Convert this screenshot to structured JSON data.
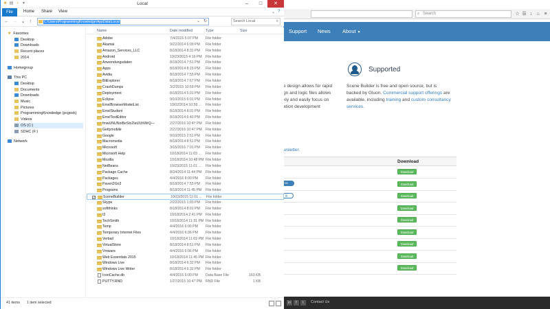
{
  "browser": {
    "search_placeholder": "Search",
    "nav": {
      "support": "Support",
      "news": "News",
      "about": "About"
    },
    "supported_title": "Supported",
    "left_lines": [
      "e design allows for rapid",
      "gn and logic files allows",
      "kly and easily focus on",
      "ation development"
    ],
    "right_text": {
      "l1": "Scene Builder is free and open source, but is",
      "l2a": "backed by Gluon. ",
      "l2_link": "Commercial support offerings",
      "l2b": " are",
      "l3a": "available, including ",
      "l3_link1": "training",
      "l3_mid": " and ",
      "l3_link2": "custom consultancy",
      "l4_link": "services",
      "l4b": "."
    },
    "newsletter": "wsletter.",
    "table_header": "Download",
    "download_label": "Download",
    "download_rows": 9,
    "pill_1": "ris",
    "pill_2": "Ⅲ",
    "footer_contact": "Contact Us",
    "accent": "#3d7fb8",
    "green": "#5cb85c"
  },
  "explorer": {
    "title": "Local",
    "tabs": {
      "file": "File",
      "home": "Home",
      "share": "Share",
      "view": "View"
    },
    "path": "C:\\Users\\ProgrammingKnowledge\\AppData\\Local",
    "search_placeholder": "Search Local",
    "nav_items": [
      {
        "label": "Favorites",
        "kind": "star",
        "indent": 0
      },
      {
        "label": "Desktop",
        "kind": "blue",
        "indent": 1
      },
      {
        "label": "Downloads",
        "kind": "blue",
        "indent": 1
      },
      {
        "label": "Recent places",
        "kind": "folder",
        "indent": 1
      },
      {
        "label": "2014",
        "kind": "folder",
        "indent": 1
      },
      {
        "label": "",
        "kind": "gap",
        "indent": 0
      },
      {
        "label": "Homegroup",
        "kind": "blue",
        "indent": 0
      },
      {
        "label": "",
        "kind": "gap",
        "indent": 0
      },
      {
        "label": "This PC",
        "kind": "pc",
        "indent": 0
      },
      {
        "label": "Desktop",
        "kind": "blue",
        "indent": 1
      },
      {
        "label": "Documents",
        "kind": "folder",
        "indent": 1
      },
      {
        "label": "Downloads",
        "kind": "blue",
        "indent": 1
      },
      {
        "label": "Music",
        "kind": "folder",
        "indent": 1
      },
      {
        "label": "Pictures",
        "kind": "folder",
        "indent": 1
      },
      {
        "label": "ProgrammingKnowledge (pcgeek)",
        "kind": "folder",
        "indent": 1
      },
      {
        "label": "Videos",
        "kind": "folder",
        "indent": 1
      },
      {
        "label": "OS (C:)",
        "kind": "drive",
        "indent": 1
      },
      {
        "label": "SDHC (F:)",
        "kind": "drive",
        "indent": 1
      },
      {
        "label": "",
        "kind": "gap",
        "indent": 0
      },
      {
        "label": "Network",
        "kind": "blue",
        "indent": 0
      }
    ],
    "columns": {
      "name": "Name",
      "date": "Date modified",
      "type": "Type",
      "size": "Size"
    },
    "files": [
      {
        "name": "Adobe",
        "date": "7/4/2015 5:07 PM",
        "type": "File folder",
        "size": ""
      },
      {
        "name": "Akamai",
        "date": "9/22/2014 6:09 PM",
        "type": "File folder",
        "size": ""
      },
      {
        "name": "Amazon_Services_LLC",
        "date": "8/18/2014 8:31 PM",
        "type": "File folder",
        "size": ""
      },
      {
        "name": "Android",
        "date": "10/23/2015 4:16 PM",
        "type": "File folder",
        "size": ""
      },
      {
        "name": "Anwendungsdaten",
        "date": "8/18/2014 7:51 PM",
        "type": "File folder",
        "size": ""
      },
      {
        "name": "Apps",
        "date": "8/18/2014 8:15 PM",
        "type": "File folder",
        "size": ""
      },
      {
        "name": "Avidia",
        "date": "8/18/2014 7:55 PM",
        "type": "File folder",
        "size": ""
      },
      {
        "name": "BitExplorer",
        "date": "8/18/2014 7:57 PM",
        "type": "File folder",
        "size": ""
      },
      {
        "name": "CrashDumps",
        "date": "3/2/2015 10:59 PM",
        "type": "File folder",
        "size": ""
      },
      {
        "name": "Deployment",
        "date": "8/18/2014 5:01 PM",
        "type": "File folder",
        "size": ""
      },
      {
        "name": "Eclipse",
        "date": "9/10/2015 6:01 PM",
        "type": "File folder",
        "size": ""
      },
      {
        "name": "EmxlBrowserModelList",
        "date": "10/02/2014 10:59 ...",
        "type": "File folder",
        "size": ""
      },
      {
        "name": "EmxlStudent",
        "date": "8/18/2014 8:01 PM",
        "type": "File folder",
        "size": ""
      },
      {
        "name": "EmxlTextEditor",
        "date": "8/18/2014 6:40 PM",
        "type": "File folder",
        "size": ""
      },
      {
        "name": "fmwUNUNoiBeStx2IetJUhWrQ—",
        "date": "2/27/2016 10:47 PM",
        "type": "File folder",
        "size": ""
      },
      {
        "name": "Gettymobile",
        "date": "2/27/2016 10:47 PM",
        "type": "File folder",
        "size": ""
      },
      {
        "name": "Google",
        "date": "9/10/2015 2:51 PM",
        "type": "File folder",
        "size": ""
      },
      {
        "name": "Macromedia",
        "date": "8/18/2014 8:51 PM",
        "type": "File folder",
        "size": ""
      },
      {
        "name": "Microsoft",
        "date": "3/15/2016 7:01 PM",
        "type": "File folder",
        "size": ""
      },
      {
        "name": "Microsoft Help",
        "date": "10/18/2014 11:03 ...",
        "type": "File folder",
        "size": ""
      },
      {
        "name": "Mozilla",
        "date": "10/18/2014 10:48 PM",
        "type": "File folder",
        "size": ""
      },
      {
        "name": "NetBeans",
        "date": "10/23/2015 11:01 ...",
        "type": "File folder",
        "size": ""
      },
      {
        "name": "Package Cache",
        "date": "8/24/2014 11:44 PM",
        "type": "File folder",
        "size": ""
      },
      {
        "name": "Packages",
        "date": "4/4/2016 8:00 PM",
        "type": "File folder",
        "size": ""
      },
      {
        "name": "Paven2Go3",
        "date": "8/18/2014 7:55 PM",
        "type": "File folder",
        "size": ""
      },
      {
        "name": "Programs",
        "date": "8/18/2014 11:45 PM",
        "type": "File folder",
        "size": ""
      },
      {
        "name": "SceneBuilder",
        "date": "10/23/2015 11:01 ...",
        "type": "File folder",
        "size": "",
        "selected": true
      },
      {
        "name": "Skype",
        "date": "2/22/2015 1:03 PM",
        "type": "File folder",
        "size": ""
      },
      {
        "name": "softthinks",
        "date": "8/18/2014 8:01 PM",
        "type": "File folder",
        "size": ""
      },
      {
        "name": "t3",
        "date": "10/18/2014 2:41 PM",
        "type": "File folder",
        "size": ""
      },
      {
        "name": "TechSmith",
        "date": "10/18/2014 11:31 PM",
        "type": "File folder",
        "size": ""
      },
      {
        "name": "Temp",
        "date": "4/4/2016 6:00 PM",
        "type": "File folder",
        "size": ""
      },
      {
        "name": "Temporary Internet Files",
        "date": "4/4/2016 6:36 PM",
        "type": "File folder",
        "size": ""
      },
      {
        "name": "Verbail",
        "date": "10/18/2014 11:03 PM",
        "type": "File folder",
        "size": ""
      },
      {
        "name": "VirtualStore",
        "date": "8/18/2014 8:51 PM",
        "type": "File folder",
        "size": ""
      },
      {
        "name": "Vmware",
        "date": "4/4/2016 6:06 PM",
        "type": "File folder",
        "size": ""
      },
      {
        "name": "Web Essentials 2015",
        "date": "10/18/2014 11:45 PM",
        "type": "File folder",
        "size": ""
      },
      {
        "name": "Windows Live",
        "date": "8/18/2014 6:32 PM",
        "type": "File folder",
        "size": ""
      },
      {
        "name": "Windows Live Writer",
        "date": "8/18/2014 6:32 PM",
        "type": "File folder",
        "size": ""
      },
      {
        "name": "IconCache.db",
        "date": "4/4/2016 6:00 PM",
        "type": "Data Base File",
        "size": "163 KB"
      },
      {
        "name": "PUTTY.RND",
        "date": "1/27/2015 10:47 PM",
        "type": "RND File",
        "size": "1 KB"
      }
    ],
    "status_items": "41 items",
    "status_selected": "1 item selected",
    "accent": "#1979ca"
  }
}
